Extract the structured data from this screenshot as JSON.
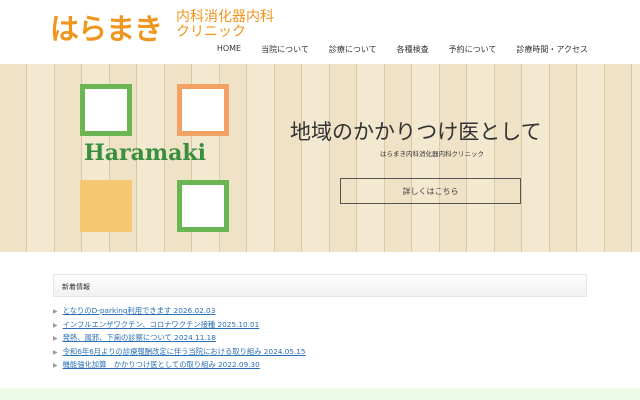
{
  "header": {
    "logo_main": "はらまき",
    "logo_sub_line1": "内科消化器内科",
    "logo_sub_line2": "クリニック"
  },
  "nav": [
    "HOME",
    "当院について",
    "診療について",
    "各種検査",
    "予約について",
    "診療時間・アクセス"
  ],
  "hero": {
    "brand": "Haramaki",
    "title": "地域のかかりつけ医として",
    "subtitle": "はらまき内科消化器内科クリニック",
    "button": "詳しくはこちら"
  },
  "news": {
    "heading": "新着情報",
    "items": [
      "となりのD-parking利用できます 2026.02.03",
      "インフルエンザワクチン、コロナワクチン接種 2025.10.01",
      "発熱、風邪、下痢の診察について 2024.11.18",
      "令和6年6月よりの診療報酬改定に伴う当院における取り組み 2024.05.15",
      "機能強化加算　かかりつけ医としての取り組み 2022.09.30"
    ]
  },
  "colors": {
    "brand_orange": "#f0951e",
    "green": "#6bb552",
    "orange_sq": "#f2a262",
    "yellow_sq": "#f7c873",
    "link": "#2a6fb5"
  }
}
